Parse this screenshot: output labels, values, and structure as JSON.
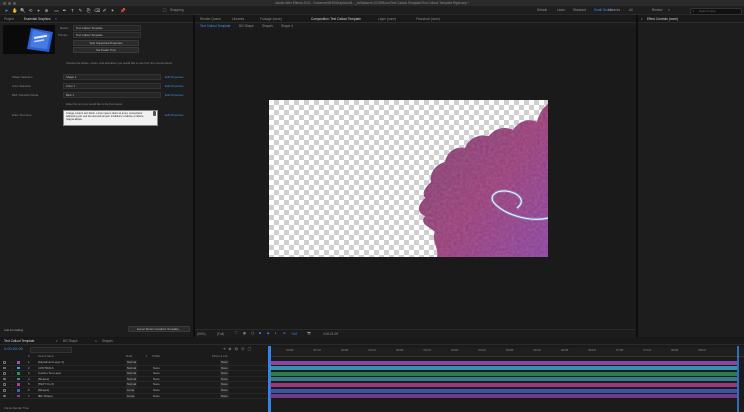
{
  "app": {
    "title": "Adobe After Effects 2023 - /Volumes/WHO/Graphics/M..._ot/Wasserb 2023/Mono/Text Callout Template/Text Callout Template Right.aep *"
  },
  "toolbar": {
    "snapping_label": "Snapping",
    "workspaces": [
      "Default",
      "Learn",
      "Standard",
      "Small Screen",
      "Libraries",
      "All",
      "Review",
      "Essential Graphics",
      "Tutorials"
    ],
    "search_placeholder": "Search Help"
  },
  "left_panel": {
    "tabs": [
      "Project",
      "Essential Graphics",
      "×"
    ],
    "master_label": "Master",
    "master_value": "Text Callout Template",
    "primary_label": "Primary",
    "primary_value": "Text Callout Template",
    "solo_button": "Solo Supported Properties",
    "poster_button": "Set Poster Time",
    "intro_text": "Choose the shape, colors, and animation you would like to use from the menus below.",
    "props": [
      {
        "label": "Shape Selection",
        "value": "Shape 1",
        "link": "Edit Properties"
      },
      {
        "label": "Color Selection",
        "value": "Color 1",
        "link": "Edit Properties"
      },
      {
        "label": "Blob Transition Mode",
        "value": "Blob 1",
        "link": "Edit Properties"
      }
    ],
    "enter_text_hint": "Enter the text you would like in the box below.",
    "enter_text_label": "Enter Text Here",
    "enter_text_value": "A large custom text block. Lorem ipsum dolor sit amet, consectetur adipiscing elit, sed do eiusmod tempor incididunt ut labore et dolore magna aliqua.",
    "enter_text_link": "Edit Properties",
    "add_formatting": "Add Formatting",
    "export_button": "Export Motion Graphics Template..."
  },
  "viewer": {
    "top_tabs": [
      "Render Queue",
      "Libraries",
      "Footage (none)",
      "Composition: Text Callout Template",
      "Layer (none)",
      "Flowchart (none)"
    ],
    "active_tab_index": 3,
    "crumbs": [
      "Text Callout Template",
      "BG Shape",
      "Shapes",
      "Shape 4"
    ],
    "zoom": "(50%)",
    "quality": "(Full)",
    "timecode": "0:00:01:09",
    "offset": "+0.0"
  },
  "effects_panel": {
    "title": "Effect Controls (none)"
  },
  "timeline": {
    "tabs": [
      "Text Callout Template",
      "BG Shape",
      "Shapes"
    ],
    "current_time": "0:00:00:00",
    "columns": [
      "#",
      "Source Name",
      "Mode",
      "T",
      "TrkMat",
      "Parent & Link"
    ],
    "layers": [
      {
        "num": "1",
        "name": "[Adjustment Layer 4]",
        "mode": "Normal",
        "trkmat": "",
        "parent": "None",
        "color": "#9b4ec0"
      },
      {
        "num": "2",
        "name": "CONTROLS",
        "mode": "Normal",
        "trkmat": "None",
        "parent": "None",
        "color": "#3aa4c7"
      },
      {
        "num": "3",
        "name": "Custom Text Layer",
        "mode": "Normal",
        "trkmat": "None",
        "parent": "None",
        "color": "#2f8d54"
      },
      {
        "num": "4",
        "name": "[Shapes]",
        "mode": "Normal",
        "trkmat": "None",
        "parent": "None",
        "color": "#3a8c9c"
      },
      {
        "num": "5",
        "name": "[TEXT On 3]",
        "mode": "Normal",
        "trkmat": "None",
        "parent": "None",
        "color": "#b43c8d"
      },
      {
        "num": "6",
        "name": "[Shapes]",
        "mode": "Luma",
        "trkmat": "None",
        "parent": "None",
        "color": "#3f5fb8"
      },
      {
        "num": "7",
        "name": "[BG Shape]",
        "mode": "Luma",
        "trkmat": "None",
        "parent": "None",
        "color": "#7e3f9d"
      }
    ],
    "ruler_ticks": [
      "01:00f",
      "01:12f",
      "02:00f",
      "02:12f",
      "03:00f",
      "03:12f",
      "04:00f",
      "04:12f",
      "05:00f",
      "05:12f",
      "06:00f",
      "06:12f",
      "07:00f",
      "07:12f",
      "08:00f",
      "08:12f"
    ],
    "footer": "Frame Render Time"
  },
  "colors": {
    "accent": "#3a8fff",
    "blob_start": "#7a3d6e",
    "blob_end": "#8a3fa0",
    "glow": "#7fd8ff"
  }
}
